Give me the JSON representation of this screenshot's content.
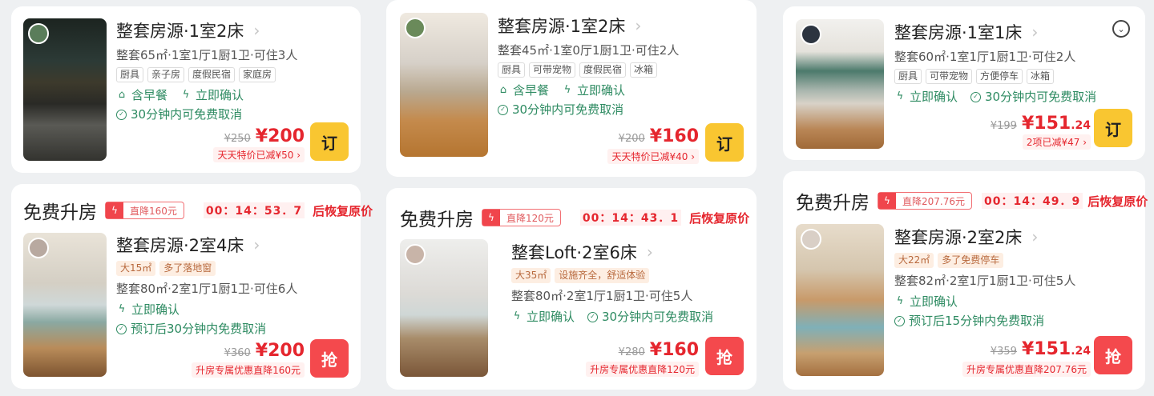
{
  "listings": {
    "c1a": {
      "title": "整套房源·1室2床",
      "chevron": "›",
      "specs": "整套65㎡·1室1厅1厨1卫·可住3人",
      "tags": [
        "厨具",
        "亲子房",
        "度假民宿",
        "家庭房"
      ],
      "feat1": "含早餐",
      "feat2": "立即确认",
      "cancel": "30分钟内可免费取消",
      "orig": "¥250",
      "price": "¥200",
      "promo": "天天特价已减¥50 ›",
      "btn": "订"
    },
    "c2a": {
      "title": "整套房源·1室2床",
      "chevron": "›",
      "specs": "整套45㎡·1室0厅1厨1卫·可住2人",
      "tags": [
        "厨具",
        "可带宠物",
        "度假民宿",
        "冰箱"
      ],
      "feat1": "含早餐",
      "feat2": "立即确认",
      "cancel": "30分钟内可免费取消",
      "orig": "¥200",
      "price": "¥160",
      "promo": "天天特价已减¥40 ›",
      "btn": "订"
    },
    "c3a": {
      "title": "整套房源·1室1床",
      "chevron": "›",
      "specs": "整套60㎡·1室1厅1厨1卫·可住2人",
      "tags": [
        "厨具",
        "可带宠物",
        "方便停车",
        "冰箱"
      ],
      "feat1": "立即确认",
      "feat2": "30分钟内可免费取消",
      "orig": "¥199",
      "price_main": "¥151",
      "price_dec": ".24",
      "promo": "2项已减¥47 ›",
      "btn": "订"
    },
    "c1b": {
      "up_title": "免费升房",
      "drop": "直降160元",
      "timer": "00：14：53．7",
      "restore": "后恢复原价",
      "title": "整套房源·2室4床",
      "chevron": "›",
      "hltags": [
        "大15㎡",
        "多了落地窗"
      ],
      "specs": "整套80㎡·2室1厅1厨1卫·可住6人",
      "feat1": "立即确认",
      "cancel": "预订后30分钟内免费取消",
      "orig": "¥360",
      "price": "¥200",
      "promo": "升房专属优惠直降160元",
      "btn": "抢"
    },
    "c2b": {
      "up_title": "免费升房",
      "drop": "直降120元",
      "timer": "00：14：43．1",
      "restore": "后恢复原价",
      "title": "整套Loft·2室6床",
      "chevron": "›",
      "hltags": [
        "大35㎡",
        "设施齐全，舒适体验"
      ],
      "specs": "整套80㎡·2室1厅1厨1卫·可住5人",
      "feat1": "立即确认",
      "feat2": "30分钟内可免费取消",
      "orig": "¥280",
      "price": "¥160",
      "promo": "升房专属优惠直降120元",
      "btn": "抢"
    },
    "c3b": {
      "up_title": "免费升房",
      "drop": "直降207.76元",
      "timer": "00：14：49．9",
      "restore": "后恢复原价",
      "title": "整套房源·2室2床",
      "chevron": "›",
      "hltags": [
        "大22㎡",
        "多了免费停车"
      ],
      "specs": "整套82㎡·2室1厅1厨1卫·可住5人",
      "feat1": "立即确认",
      "cancel": "预订后15分钟内免费取消",
      "orig": "¥359",
      "price_main": "¥151",
      "price_dec": ".24",
      "promo": "升房专属优惠直降207.76元",
      "btn": "抢"
    }
  },
  "icons": {
    "breakfast": "breakfast-icon",
    "bolt": "lightning-icon",
    "check": "check-circle-icon",
    "collapse": "chevron-down-circle-icon"
  },
  "colors": {
    "green": "#2e8b62",
    "red": "#e5262e",
    "order_btn": "#f9c631",
    "grab_btn": "#f4494d"
  }
}
